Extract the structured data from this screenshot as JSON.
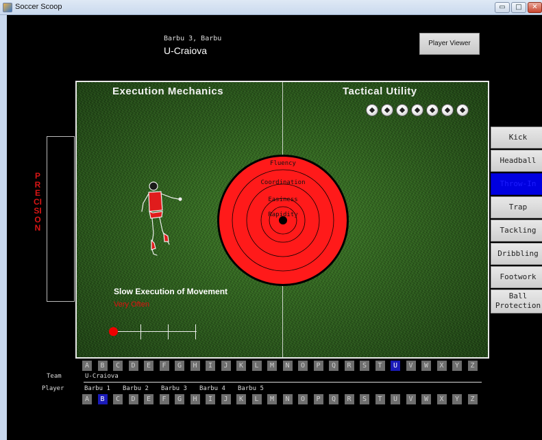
{
  "window": {
    "title": "Soccer Scoop",
    "min_glyph": "▭",
    "max_glyph": "□",
    "close_glyph": "✕",
    "app_icon": "coffee-cup-icon"
  },
  "header": {
    "player_name": "Barbu 3, Barbu",
    "team": "U-Craiova",
    "viewer_button": "Player Viewer"
  },
  "field": {
    "left_title": "Execution Mechanics",
    "right_title": "Tactical Utility",
    "rating_balls": 7,
    "target_rings": [
      "Fluency",
      "Coordination",
      "Easiness",
      "Rapidity"
    ],
    "ring_color": "#ff1a1a",
    "execution_label": "Slow Execution of Movement",
    "frequency_label": "Very Often",
    "slider_level": 0
  },
  "side": {
    "precision_label": "PRECISION"
  },
  "menu": {
    "items": [
      "Kick",
      "Headball",
      "Throw-In",
      "Trap",
      "Tackling",
      "Dribbling",
      "Footwork",
      "Ball Protection"
    ],
    "active_index": 2
  },
  "letters": [
    "A",
    "B",
    "C",
    "D",
    "E",
    "F",
    "G",
    "H",
    "I",
    "J",
    "K",
    "L",
    "M",
    "N",
    "O",
    "P",
    "Q",
    "R",
    "S",
    "T",
    "U",
    "V",
    "W",
    "X",
    "Y",
    "Z"
  ],
  "team_letters_active": "U",
  "player_letters_active": "B",
  "bottom": {
    "team_label": "Team",
    "team_value": "U-Craiova",
    "player_label": "Player",
    "players": [
      "Barbu 1",
      "Barbu 2",
      "Barbu 3",
      "Barbu 4",
      "Barbu 5"
    ]
  }
}
